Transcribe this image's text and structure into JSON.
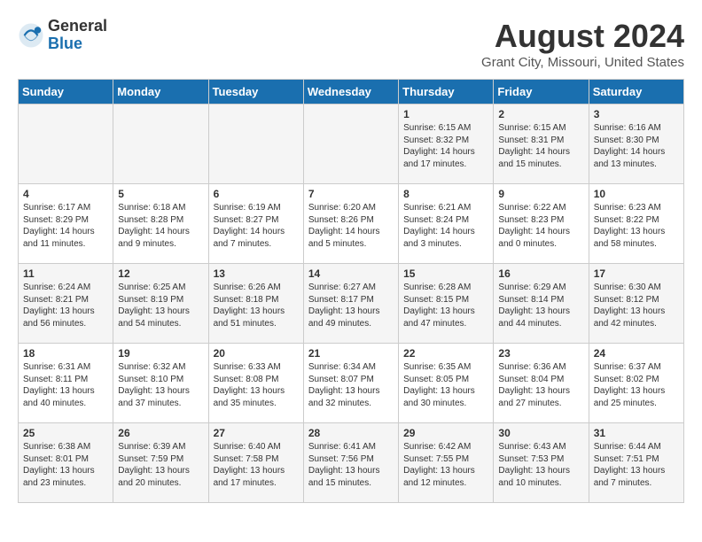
{
  "logo": {
    "general": "General",
    "blue": "Blue"
  },
  "title": {
    "month_year": "August 2024",
    "location": "Grant City, Missouri, United States"
  },
  "days_of_week": [
    "Sunday",
    "Monday",
    "Tuesday",
    "Wednesday",
    "Thursday",
    "Friday",
    "Saturday"
  ],
  "weeks": [
    [
      {
        "day": "",
        "info": ""
      },
      {
        "day": "",
        "info": ""
      },
      {
        "day": "",
        "info": ""
      },
      {
        "day": "",
        "info": ""
      },
      {
        "day": "1",
        "info": "Sunrise: 6:15 AM\nSunset: 8:32 PM\nDaylight: 14 hours\nand 17 minutes."
      },
      {
        "day": "2",
        "info": "Sunrise: 6:15 AM\nSunset: 8:31 PM\nDaylight: 14 hours\nand 15 minutes."
      },
      {
        "day": "3",
        "info": "Sunrise: 6:16 AM\nSunset: 8:30 PM\nDaylight: 14 hours\nand 13 minutes."
      }
    ],
    [
      {
        "day": "4",
        "info": "Sunrise: 6:17 AM\nSunset: 8:29 PM\nDaylight: 14 hours\nand 11 minutes."
      },
      {
        "day": "5",
        "info": "Sunrise: 6:18 AM\nSunset: 8:28 PM\nDaylight: 14 hours\nand 9 minutes."
      },
      {
        "day": "6",
        "info": "Sunrise: 6:19 AM\nSunset: 8:27 PM\nDaylight: 14 hours\nand 7 minutes."
      },
      {
        "day": "7",
        "info": "Sunrise: 6:20 AM\nSunset: 8:26 PM\nDaylight: 14 hours\nand 5 minutes."
      },
      {
        "day": "8",
        "info": "Sunrise: 6:21 AM\nSunset: 8:24 PM\nDaylight: 14 hours\nand 3 minutes."
      },
      {
        "day": "9",
        "info": "Sunrise: 6:22 AM\nSunset: 8:23 PM\nDaylight: 14 hours\nand 0 minutes."
      },
      {
        "day": "10",
        "info": "Sunrise: 6:23 AM\nSunset: 8:22 PM\nDaylight: 13 hours\nand 58 minutes."
      }
    ],
    [
      {
        "day": "11",
        "info": "Sunrise: 6:24 AM\nSunset: 8:21 PM\nDaylight: 13 hours\nand 56 minutes."
      },
      {
        "day": "12",
        "info": "Sunrise: 6:25 AM\nSunset: 8:19 PM\nDaylight: 13 hours\nand 54 minutes."
      },
      {
        "day": "13",
        "info": "Sunrise: 6:26 AM\nSunset: 8:18 PM\nDaylight: 13 hours\nand 51 minutes."
      },
      {
        "day": "14",
        "info": "Sunrise: 6:27 AM\nSunset: 8:17 PM\nDaylight: 13 hours\nand 49 minutes."
      },
      {
        "day": "15",
        "info": "Sunrise: 6:28 AM\nSunset: 8:15 PM\nDaylight: 13 hours\nand 47 minutes."
      },
      {
        "day": "16",
        "info": "Sunrise: 6:29 AM\nSunset: 8:14 PM\nDaylight: 13 hours\nand 44 minutes."
      },
      {
        "day": "17",
        "info": "Sunrise: 6:30 AM\nSunset: 8:12 PM\nDaylight: 13 hours\nand 42 minutes."
      }
    ],
    [
      {
        "day": "18",
        "info": "Sunrise: 6:31 AM\nSunset: 8:11 PM\nDaylight: 13 hours\nand 40 minutes."
      },
      {
        "day": "19",
        "info": "Sunrise: 6:32 AM\nSunset: 8:10 PM\nDaylight: 13 hours\nand 37 minutes."
      },
      {
        "day": "20",
        "info": "Sunrise: 6:33 AM\nSunset: 8:08 PM\nDaylight: 13 hours\nand 35 minutes."
      },
      {
        "day": "21",
        "info": "Sunrise: 6:34 AM\nSunset: 8:07 PM\nDaylight: 13 hours\nand 32 minutes."
      },
      {
        "day": "22",
        "info": "Sunrise: 6:35 AM\nSunset: 8:05 PM\nDaylight: 13 hours\nand 30 minutes."
      },
      {
        "day": "23",
        "info": "Sunrise: 6:36 AM\nSunset: 8:04 PM\nDaylight: 13 hours\nand 27 minutes."
      },
      {
        "day": "24",
        "info": "Sunrise: 6:37 AM\nSunset: 8:02 PM\nDaylight: 13 hours\nand 25 minutes."
      }
    ],
    [
      {
        "day": "25",
        "info": "Sunrise: 6:38 AM\nSunset: 8:01 PM\nDaylight: 13 hours\nand 23 minutes."
      },
      {
        "day": "26",
        "info": "Sunrise: 6:39 AM\nSunset: 7:59 PM\nDaylight: 13 hours\nand 20 minutes."
      },
      {
        "day": "27",
        "info": "Sunrise: 6:40 AM\nSunset: 7:58 PM\nDaylight: 13 hours\nand 17 minutes."
      },
      {
        "day": "28",
        "info": "Sunrise: 6:41 AM\nSunset: 7:56 PM\nDaylight: 13 hours\nand 15 minutes."
      },
      {
        "day": "29",
        "info": "Sunrise: 6:42 AM\nSunset: 7:55 PM\nDaylight: 13 hours\nand 12 minutes."
      },
      {
        "day": "30",
        "info": "Sunrise: 6:43 AM\nSunset: 7:53 PM\nDaylight: 13 hours\nand 10 minutes."
      },
      {
        "day": "31",
        "info": "Sunrise: 6:44 AM\nSunset: 7:51 PM\nDaylight: 13 hours\nand 7 minutes."
      }
    ]
  ]
}
